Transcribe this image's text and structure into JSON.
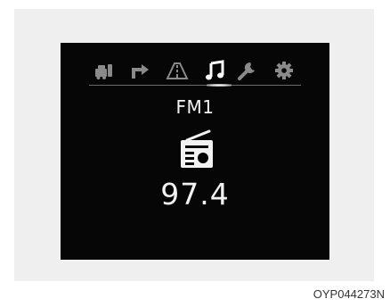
{
  "display": {
    "tabs": [
      {
        "icon": "car-info-icon",
        "active": false
      },
      {
        "icon": "turn-arrow-icon",
        "active": false
      },
      {
        "icon": "road-icon",
        "active": false
      },
      {
        "icon": "music-note-icon",
        "active": true
      },
      {
        "icon": "wrench-icon",
        "active": false
      },
      {
        "icon": "gear-icon",
        "active": false
      }
    ],
    "band": "FM1",
    "source_icon": "radio-icon",
    "frequency": "97.4"
  },
  "image_code": "OYP044273N",
  "colors": {
    "screen_bg": "#060606",
    "tab_inactive": "#8a8a8a",
    "tab_active": "#ffffff",
    "text": "#f2f2f2"
  }
}
